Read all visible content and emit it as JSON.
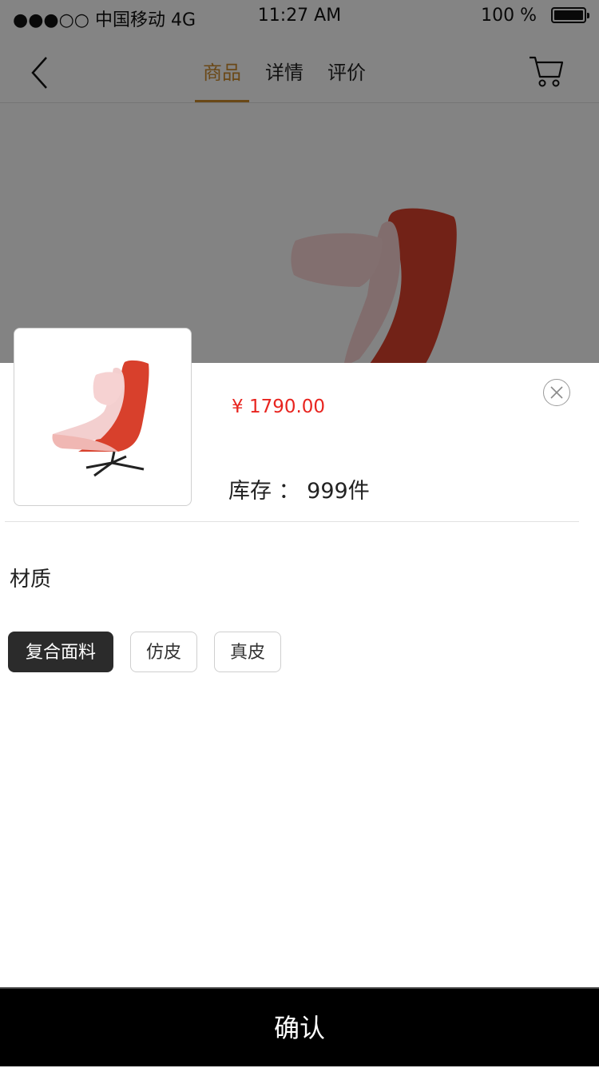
{
  "status_bar": {
    "carrier": "●●●○○ 中国移动 4G",
    "time": "11:27 AM",
    "battery": "100 %"
  },
  "nav": {
    "tabs": [
      {
        "label": "商品",
        "active": true
      },
      {
        "label": "详情"
      },
      {
        "label": "评价"
      }
    ],
    "icons": {
      "back": "back-chevron-icon",
      "cart": "cart-icon"
    }
  },
  "product": {
    "price": "¥ 1790.00",
    "stock": "库存 ： 999件"
  },
  "spec": {
    "title": "材质",
    "options": [
      {
        "label": "复合面料",
        "selected": true
      },
      {
        "label": "仿皮"
      },
      {
        "label": "真皮"
      }
    ]
  },
  "confirm_label": "确认",
  "colors": {
    "accent": "#c8892d",
    "price": "#e8241f",
    "dark": "#2b2b2b",
    "chair_red": "#d8402c",
    "chair_pink": "#f6d2d2"
  }
}
